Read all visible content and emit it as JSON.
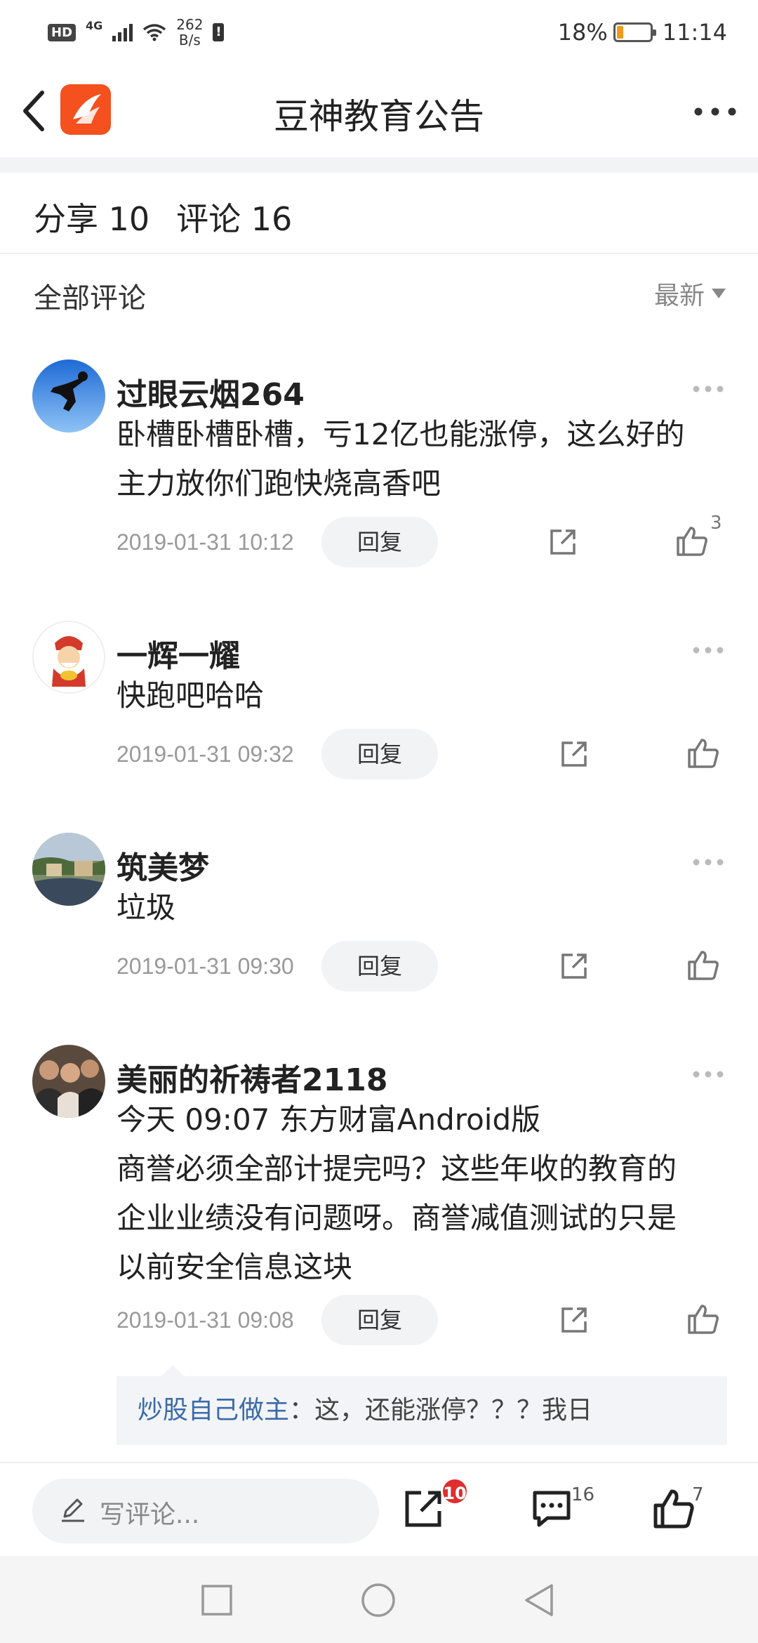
{
  "status_bar": {
    "hd": "HD",
    "network": "4G",
    "speed_value": "262",
    "speed_unit": "B/s",
    "alert": "!",
    "battery_percent": "18%",
    "battery_level": 0.18,
    "time": "11:14"
  },
  "header": {
    "title": "豆神教育公告"
  },
  "stats": {
    "shares": "分享 10",
    "comments": "评论 16"
  },
  "section": {
    "title": "全部评论",
    "sort_label": "最新"
  },
  "comments": [
    {
      "name": "过眼云烟264",
      "lines": [
        "卧槽卧槽卧槽，亏12亿也能涨停，这么好的",
        "主力放你们跑快烧高香吧"
      ],
      "time": "2019-01-31 10:12",
      "reply_label": "回复",
      "likes": "3",
      "avatar": "avatar-sky-jump"
    },
    {
      "name": "一辉一耀",
      "lines": [
        "快跑吧哈哈"
      ],
      "time": "2019-01-31 09:32",
      "reply_label": "回复",
      "likes": "",
      "avatar": "avatar-fortune-god"
    },
    {
      "name": "筑美梦",
      "lines": [
        "垃圾"
      ],
      "time": "2019-01-31 09:30",
      "reply_label": "回复",
      "likes": "",
      "avatar": "avatar-village-painting"
    },
    {
      "name": "美丽的祈祷者2118",
      "lines": [
        "今天 09:07 东方财富Android版",
        "商誉必须全部计提完吗？这些年收的教育的",
        "企业业绩没有问题呀。商誉减值测试的只是",
        "以前安全信息这块"
      ],
      "time": "2019-01-31 09:08",
      "reply_label": "回复",
      "likes": "",
      "avatar": "avatar-group-photo"
    }
  ],
  "sub_reply": {
    "author": "炒股自己做主",
    "text": "：这，还能涨停？？？我日"
  },
  "action_bar": {
    "input_placeholder": "写评论...",
    "share_badge": "10",
    "comment_count": "16",
    "like_count": "7"
  },
  "colors": {
    "brand": "#f4511e",
    "link": "#3b6aa8",
    "badge": "#e02d2d"
  },
  "icons": [
    "back-icon",
    "app-logo",
    "more-icon",
    "share-icon",
    "like-icon",
    "pencil-icon",
    "comment-icon",
    "recent-apps-icon",
    "home-icon",
    "back-nav-icon"
  ]
}
